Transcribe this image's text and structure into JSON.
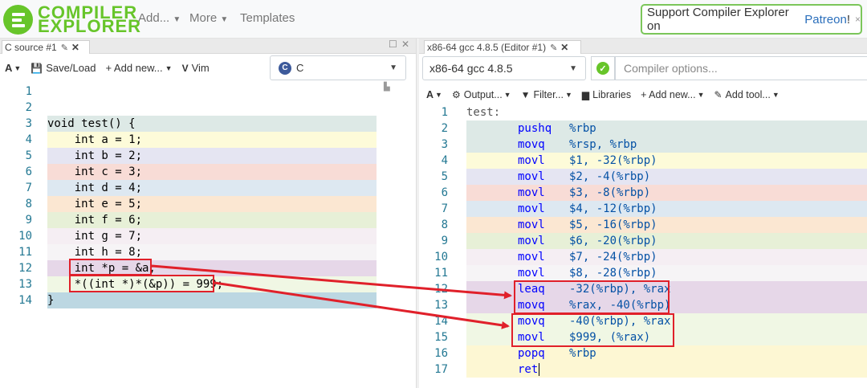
{
  "navbar": {
    "logo_line1": "COMPILER",
    "logo_line2": "EXPLORER",
    "add_menu": "Add...",
    "more_menu": "More",
    "templates": "Templates",
    "patreon_text": "Support Compiler Explorer on",
    "patreon_link": "Patreon",
    "patreon_suffix": "!",
    "patreon_close": "×"
  },
  "left_pane": {
    "tab_title": "C source #1",
    "toolbar": {
      "font_label": "A",
      "save_load": "Save/Load",
      "add_new": "+ Add new...",
      "vim": "Vim"
    },
    "language": "C",
    "lines": [
      {
        "n": "1",
        "code": ""
      },
      {
        "n": "2",
        "code": ""
      },
      {
        "n": "3",
        "code": "void test() {"
      },
      {
        "n": "4",
        "code": "    int a = 1;"
      },
      {
        "n": "5",
        "code": "    int b = 2;"
      },
      {
        "n": "6",
        "code": "    int c = 3;"
      },
      {
        "n": "7",
        "code": "    int d = 4;"
      },
      {
        "n": "8",
        "code": "    int e = 5;"
      },
      {
        "n": "9",
        "code": "    int f = 6;"
      },
      {
        "n": "10",
        "code": "    int g = 7;"
      },
      {
        "n": "11",
        "code": "    int h = 8;"
      },
      {
        "n": "12",
        "code": "    int *p = &a;"
      },
      {
        "n": "13",
        "code": "    *((int *)*(&p)) = 999;"
      },
      {
        "n": "14",
        "code": "}"
      }
    ]
  },
  "right_pane": {
    "tab_title": "x86-64 gcc 4.8.5 (Editor #1)",
    "compiler": "x86-64 gcc 4.8.5",
    "options_placeholder": "Compiler options...",
    "toolbar": {
      "font_label": "A",
      "output": "Output...",
      "filter": "Filter...",
      "libraries": "Libraries",
      "add_new": "+ Add new...",
      "add_tool": "Add tool..."
    },
    "lines": [
      {
        "n": "1",
        "op": "test:",
        "args": ""
      },
      {
        "n": "2",
        "op": "pushq",
        "args": "%rbp"
      },
      {
        "n": "3",
        "op": "movq",
        "args": "%rsp, %rbp"
      },
      {
        "n": "4",
        "op": "movl",
        "args": "$1, -32(%rbp)"
      },
      {
        "n": "5",
        "op": "movl",
        "args": "$2, -4(%rbp)"
      },
      {
        "n": "6",
        "op": "movl",
        "args": "$3, -8(%rbp)"
      },
      {
        "n": "7",
        "op": "movl",
        "args": "$4, -12(%rbp)"
      },
      {
        "n": "8",
        "op": "movl",
        "args": "$5, -16(%rbp)"
      },
      {
        "n": "9",
        "op": "movl",
        "args": "$6, -20(%rbp)"
      },
      {
        "n": "10",
        "op": "movl",
        "args": "$7, -24(%rbp)"
      },
      {
        "n": "11",
        "op": "movl",
        "args": "$8, -28(%rbp)"
      },
      {
        "n": "12",
        "op": "leaq",
        "args": "-32(%rbp), %rax"
      },
      {
        "n": "13",
        "op": "movq",
        "args": "%rax, -40(%rbp)"
      },
      {
        "n": "14",
        "op": "movq",
        "args": "-40(%rbp), %rax"
      },
      {
        "n": "15",
        "op": "movl",
        "args": "$999, (%rax)"
      },
      {
        "n": "16",
        "op": "popq",
        "args": "%rbp"
      },
      {
        "n": "17",
        "op": "ret",
        "args": ""
      }
    ]
  },
  "colors": {
    "accent": "#67c52a",
    "annotation": "#e0202a",
    "line_highlights": [
      "#dde9e6",
      "#fdfbd9",
      "#e5e5f2",
      "#f8dcd6",
      "#dde8f1",
      "#fbe7d2",
      "#e7f0d7",
      "#f5eef3",
      "#f6f4f6",
      "#e6d7e8",
      "#f0f7e4",
      "#bcd7e2",
      "#fdf7d3"
    ]
  }
}
